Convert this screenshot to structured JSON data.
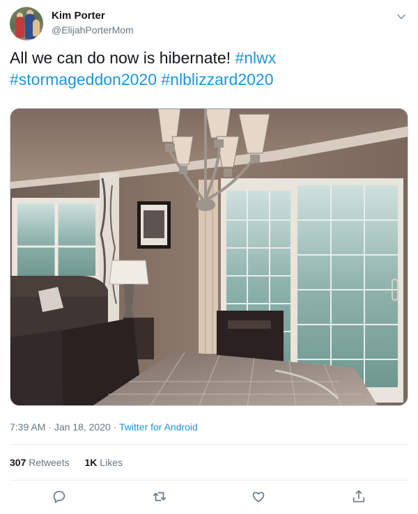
{
  "tweet": {
    "author_name": "Kim Porter",
    "author_handle": "@ElijahPorterMom",
    "text_plain": "All we can do now is hibernate! ",
    "hashtags": [
      "#nlwx",
      "#stormageddon2020",
      "#nlblizzard2020"
    ],
    "time": "7:39 AM",
    "separator": " · ",
    "date": "Jan 18, 2020",
    "source": "Twitter for Android",
    "retweets_count": "307",
    "retweets_label": "Retweets",
    "likes_count": "1K",
    "likes_label": "Likes"
  },
  "icons": {
    "caret": "chevron-down-icon",
    "reply": "reply-icon",
    "retweet": "retweet-icon",
    "like": "heart-icon",
    "share": "share-icon"
  },
  "colors": {
    "link": "#1b95e0",
    "secondary_text": "#657786",
    "primary_text": "#14171a",
    "divider": "#e6ecf0"
  }
}
